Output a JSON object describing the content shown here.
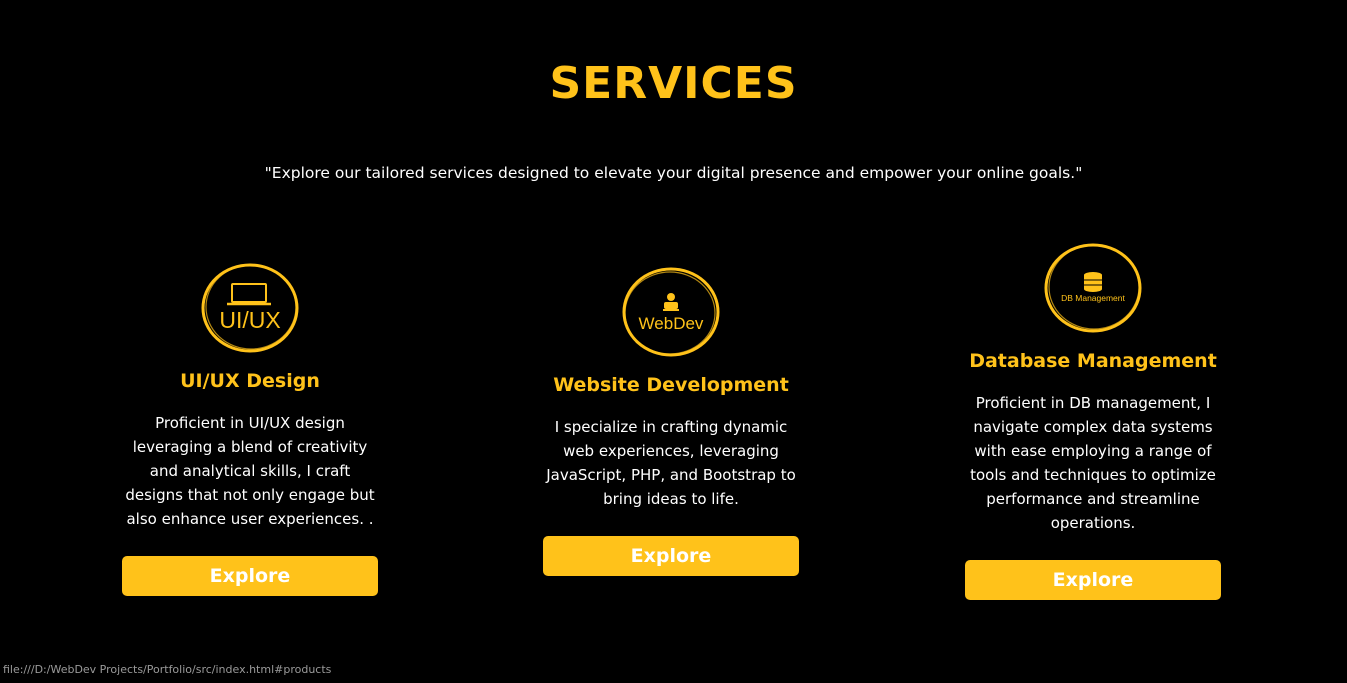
{
  "header": {
    "title": "SERVICES",
    "subtitle": "\"Explore our tailored services designed to elevate your digital presence and empower your online goals.\""
  },
  "services": [
    {
      "logo_text": "UI/UX",
      "title": "UI/UX Design",
      "description": "Proficient in UI/UX design leveraging a blend of creativity and analytical skills, I craft designs that not only engage but also enhance user experiences. .",
      "button_label": "Explore",
      "icon": "laptop-icon"
    },
    {
      "logo_text": "WebDev",
      "title": "Website Development",
      "description": "I specialize in crafting dynamic web experiences, leveraging JavaScript, PHP, and Bootstrap to bring ideas to life.",
      "button_label": "Explore",
      "icon": "coder-icon"
    },
    {
      "logo_text": "DB Management",
      "title": "Database Management",
      "description": "Proficient in DB management, I navigate complex data systems with ease employing a range of tools and techniques to optimize performance and streamline operations.",
      "button_label": "Explore",
      "icon": "database-icon"
    }
  ],
  "status_bar": {
    "url": "file:///D:/WebDev Projects/Portfolio/src/index.html#products"
  },
  "colors": {
    "accent": "#ffc21a",
    "background": "#000000",
    "text": "#ffffff"
  }
}
